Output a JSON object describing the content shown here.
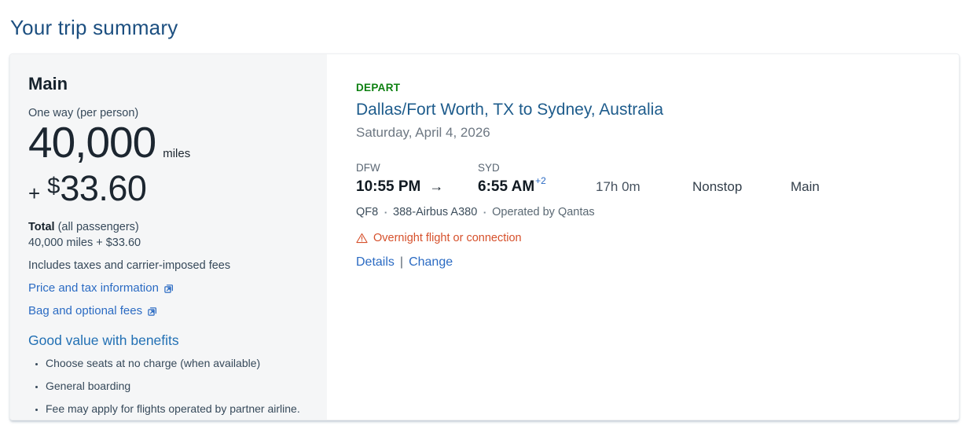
{
  "page": {
    "title": "Your trip summary"
  },
  "fare_panel": {
    "cabin": "Main",
    "per_person_label": "One way (per person)",
    "miles_value": "40,000",
    "miles_unit": "miles",
    "plus_sign": "+",
    "currency_symbol": "$",
    "cash_value": "33.60",
    "total_label": "Total",
    "total_sublabel": " (all passengers)",
    "total_amounts": "40,000 miles + $33.60",
    "includes_note": "Includes taxes and carrier-imposed fees",
    "links": [
      {
        "label": "Price and tax information",
        "icon": "external-link-icon"
      },
      {
        "label": "Bag and optional fees",
        "icon": "external-link-icon"
      }
    ],
    "benefits": {
      "heading": "Good value with benefits",
      "items": [
        "Choose seats at no charge (when available)",
        "General boarding",
        "Fee may apply for flights operated by partner airline."
      ]
    }
  },
  "flight_panel": {
    "direction_label": "DEPART",
    "route": "Dallas/Fort Worth, TX to Sydney, Australia",
    "date": "Saturday, April 4, 2026",
    "segment": {
      "origin_code": "DFW",
      "departure_time": "10:55 PM",
      "arrow": "→",
      "destination_code": "SYD",
      "arrival_time": "6:55 AM",
      "arrival_day_offset": "+2",
      "duration": "17h 0m",
      "stops": "Nonstop",
      "cabin": "Main",
      "flight_number": "QF8",
      "bullet": "▪",
      "aircraft": "388-Airbus A380",
      "operated_by": "Operated by Qantas"
    },
    "warning": "Overnight flight or connection",
    "actions": {
      "details": "Details",
      "separator": "|",
      "change": "Change"
    }
  },
  "colors": {
    "title_blue": "#1C4F80",
    "route_blue": "#1E5C8C",
    "link_blue": "#2B6BC3",
    "depart_green": "#0E8112",
    "warning_orange": "#D6502B",
    "body_gray": "#36495A",
    "panel_gray": "#F5F6F7",
    "near_black": "#16222C"
  }
}
